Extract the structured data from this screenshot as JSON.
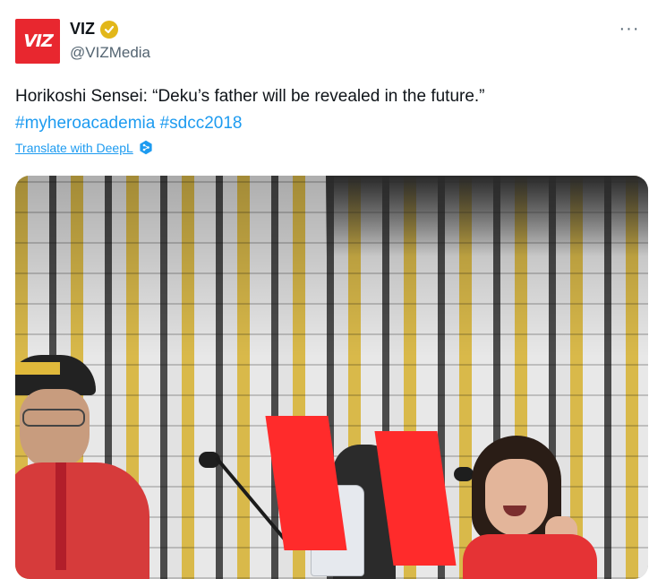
{
  "tweet": {
    "avatar_text": "VIZ",
    "display_name": "VIZ",
    "handle": "@VIZMedia",
    "more_label": "···",
    "text": "Horikoshi Sensei: “Deku’s father will be revealed in the future.”",
    "hashtags": [
      "#myheroacademia",
      "#sdcc2018"
    ],
    "translate_label": "Translate with DeepL",
    "colors": {
      "link": "#1d9bf0",
      "avatar_bg": "#e8272f",
      "verified_badge": "#e2b719",
      "text": "#0f1419",
      "secondary_text": "#536471"
    },
    "icons": {
      "verified": "verified-badge-icon",
      "more": "more-horizontal-icon",
      "deepl": "deepl-icon"
    }
  }
}
